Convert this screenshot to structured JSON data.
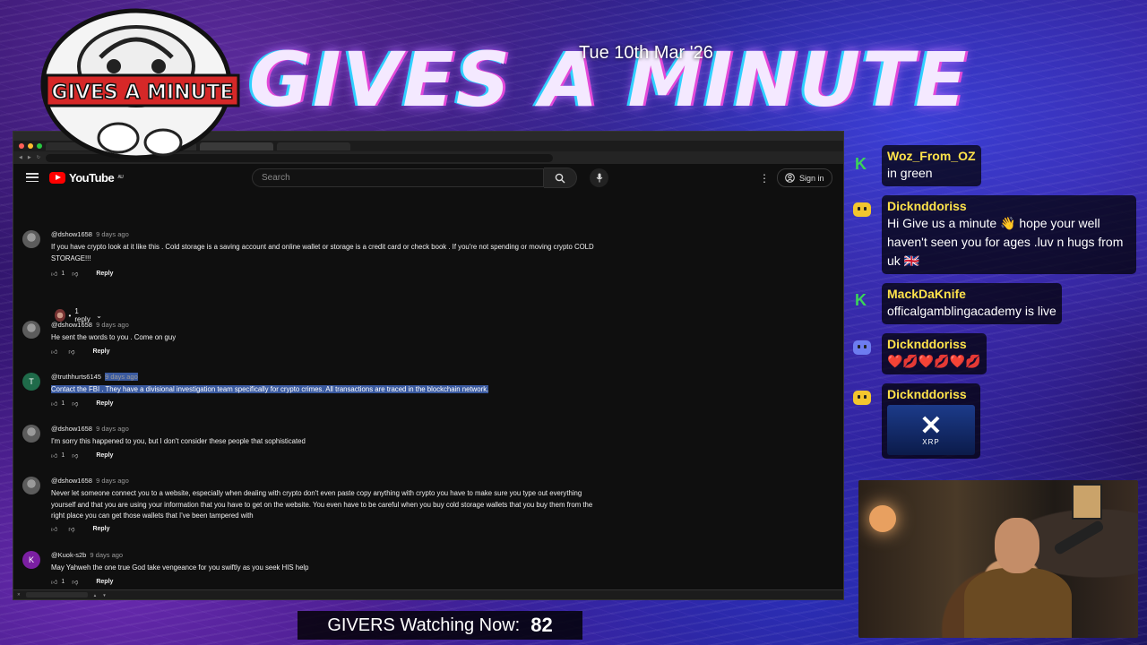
{
  "stream": {
    "date": "Tue 10th Mar '26",
    "banner_title": "GIVES A MINUTE",
    "logo_text": "GIVES A MINUTE",
    "viewers_label": "GIVERS Watching Now:",
    "viewers_count": "82"
  },
  "youtube": {
    "logo_text": "YouTube",
    "country": "AU",
    "search_placeholder": "Search",
    "sign_in_label": "Sign in"
  },
  "comments": [
    {
      "author": "@dshow1658",
      "time": "9 days ago",
      "text": "If you have crypto look at it like this . Cold storage is a saving account and online wallet or storage is a credit card or check book . If you're not spending or moving crypto COLD STORAGE!!!",
      "likes": "1",
      "reply_label": "Reply"
    },
    {
      "author": "@dshow1658",
      "time": "9 days ago",
      "text": "He sent the words to you . Come on guy",
      "likes": "",
      "reply_label": "Reply"
    },
    {
      "author": "@truthhurts6145",
      "time": "9 days ago",
      "avatar_letter": "T",
      "text": "Contact the FBI . They have a divisional investigation team specifically for crypto crimes. All transactions are traced in the blockchain network.",
      "likes": "1",
      "reply_label": "Reply"
    },
    {
      "author": "@dshow1658",
      "time": "9 days ago",
      "text": "I'm sorry this happened to you, but I don't consider these people that sophisticated",
      "likes": "1",
      "reply_label": "Reply"
    },
    {
      "author": "@dshow1658",
      "time": "9 days ago",
      "text": "Never let someone connect you to a website, especially when dealing with crypto don't even paste copy anything with crypto you have to make sure you type out everything yourself and that you are using your information that you have to get on the website. You even have to be careful when you buy cold storage wallets that you buy them from the right place you can get those wallets that I've been tampered with",
      "likes": "",
      "reply_label": "Reply"
    },
    {
      "author": "@Kuok-s2b",
      "time": "9 days ago",
      "avatar_letter": "K",
      "text": "May Yahweh the one true God take vengeance for you swiftly as you seek HIS help",
      "likes": "1",
      "reply_label": "Reply"
    }
  ],
  "replies_toggle": "1 reply",
  "chat": [
    {
      "name": "Woz_From_OZ",
      "text": "in green",
      "badge": "k"
    },
    {
      "name": "Dicknddoriss",
      "text": "Hi Give us a minute 👋 hope your well haven't seen you for ages .luv n hugs from uk 🇬🇧",
      "badge": "bot"
    },
    {
      "name": "MackDaKnife",
      "text": "officalgamblingacademy is live",
      "badge": "k"
    },
    {
      "name": "Dicknddoriss",
      "text": "❤️💋❤️💋❤️💋",
      "badge": "bot-blue"
    },
    {
      "name": "Dicknddoriss",
      "text": "",
      "badge": "bot",
      "image_label": "XRP"
    }
  ],
  "colors": {
    "chat_name": "#ffe34a",
    "yt_red": "#ff0000",
    "highlight": "#3a5aa0"
  }
}
